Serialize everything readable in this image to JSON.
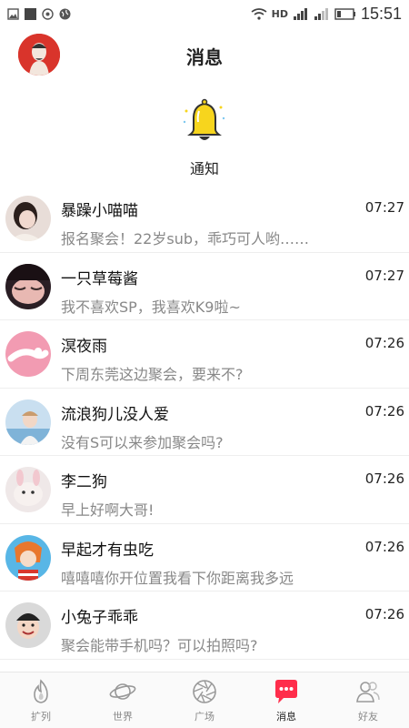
{
  "status_bar": {
    "network": "HD",
    "time": "15:51"
  },
  "header": {
    "title": "消息"
  },
  "notification": {
    "label": "通知"
  },
  "chats": [
    {
      "name": "暴躁小喵喵",
      "time": "07:27",
      "message": "报名聚会！22岁sub，乖巧可人哟……",
      "avatar_color": "#d8c9c4"
    },
    {
      "name": "一只草莓酱",
      "time": "07:27",
      "message": "我不喜欢SP，我喜欢K9啦~",
      "avatar_color": "#3a2a30"
    },
    {
      "name": "溟夜雨",
      "time": "07:26",
      "message": "下周东莞这边聚会，要来不?",
      "avatar_color": "#f29bb2"
    },
    {
      "name": "流浪狗儿没人爱",
      "time": "07:26",
      "message": "没有S可以来参加聚会吗?",
      "avatar_color": "#b9d3e6"
    },
    {
      "name": "李二狗",
      "time": "07:26",
      "message": "早上好啊大哥!",
      "avatar_color": "#e6dcdc"
    },
    {
      "name": "早起才有虫吃",
      "time": "07:26",
      "message": "嘻嘻嘻你开位置我看下你距离我多远",
      "avatar_color": "#3fa7dc"
    },
    {
      "name": "小兔子乖乖",
      "time": "07:26",
      "message": "聚会能带手机吗？可以拍照吗?",
      "avatar_color": "#cfcfcf"
    }
  ],
  "tabs": [
    {
      "label": "扩列",
      "icon": "flame-icon",
      "active": false
    },
    {
      "label": "世界",
      "icon": "planet-icon",
      "active": false
    },
    {
      "label": "广场",
      "icon": "aperture-icon",
      "active": false
    },
    {
      "label": "消息",
      "icon": "chat-bubble-icon",
      "active": true
    },
    {
      "label": "好友",
      "icon": "friends-icon",
      "active": false
    }
  ],
  "colors": {
    "active_tab": "#ff2d4b",
    "bell": "#f7d51d",
    "my_avatar": "#d9342b"
  }
}
